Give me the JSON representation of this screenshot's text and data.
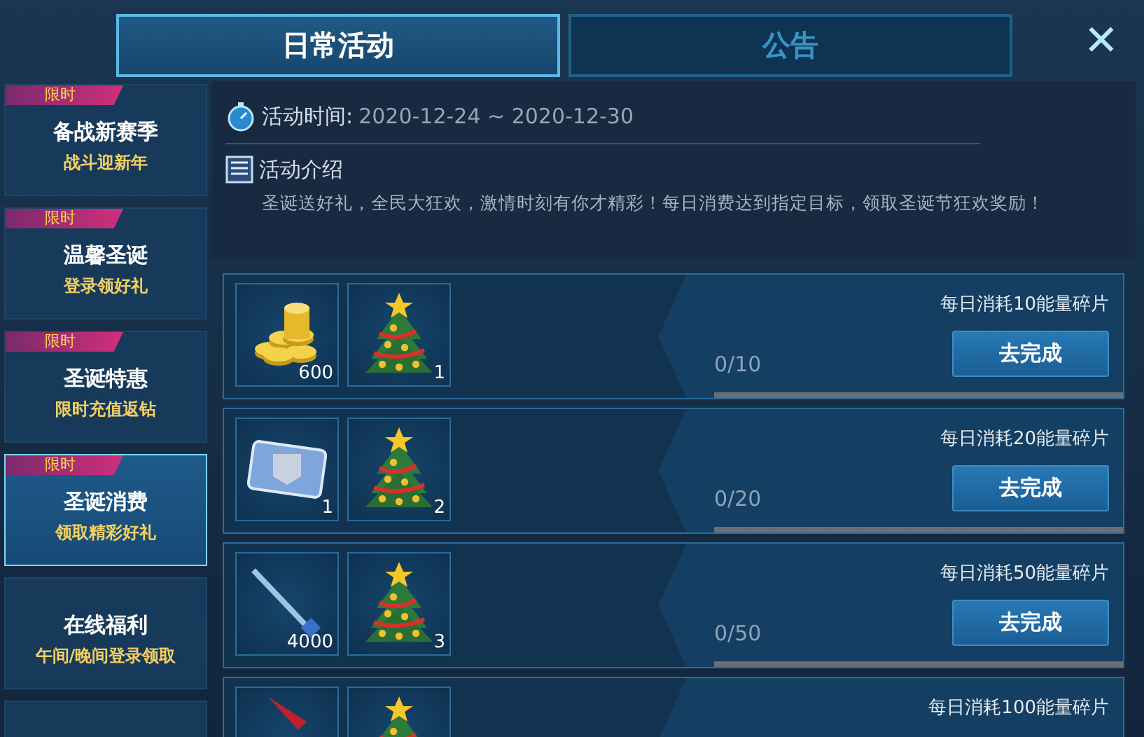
{
  "tabs": [
    {
      "label": "日常活动",
      "selected": true
    },
    {
      "label": "公告",
      "selected": false
    }
  ],
  "close": {
    "label": "✕"
  },
  "sidebar": {
    "items": [
      {
        "tag": "限时",
        "title": "备战新赛季",
        "subtitle": "战斗迎新年",
        "selected": false
      },
      {
        "tag": "限时",
        "title": "温馨圣诞",
        "subtitle": "登录领好礼",
        "selected": false
      },
      {
        "tag": "限时",
        "title": "圣诞特惠",
        "subtitle": "限时充值返钻",
        "selected": false
      },
      {
        "tag": "限时",
        "title": "圣诞消费",
        "subtitle": "领取精彩好礼",
        "selected": true
      },
      {
        "title": "在线福利",
        "subtitle": "午间/晚间登录领取",
        "selected": false
      },
      {
        "selected": false
      }
    ]
  },
  "info": {
    "time_label": "活动时间:",
    "time_value": "2020-12-24 ~ 2020-12-30",
    "intro_label": "活动介绍",
    "intro_text": "圣诞送好礼，全民大狂欢，激情时刻有你才精彩！每日消费达到指定目标，领取圣诞节狂欢奖励！"
  },
  "tasks": [
    {
      "rewards": [
        {
          "kind": "coins",
          "count": "600"
        },
        {
          "kind": "tree",
          "count": "1"
        }
      ],
      "title": "每日消耗10能量碎片",
      "progress": "0/10",
      "level": 0,
      "button": "去完成"
    },
    {
      "rewards": [
        {
          "kind": "xp",
          "count": "1"
        },
        {
          "kind": "tree",
          "count": "2"
        }
      ],
      "title": "每日消耗20能量碎片",
      "progress": "0/20",
      "level": 0,
      "button": "去完成"
    },
    {
      "rewards": [
        {
          "kind": "sword",
          "count": "4000"
        },
        {
          "kind": "tree",
          "count": "3"
        }
      ],
      "title": "每日消耗50能量碎片",
      "progress": "0/50",
      "level": 0,
      "button": "去完成"
    },
    {
      "rewards": [
        {
          "kind": "blade"
        },
        {
          "kind": "tree"
        }
      ],
      "title": "每日消耗100能量碎片"
    }
  ]
}
